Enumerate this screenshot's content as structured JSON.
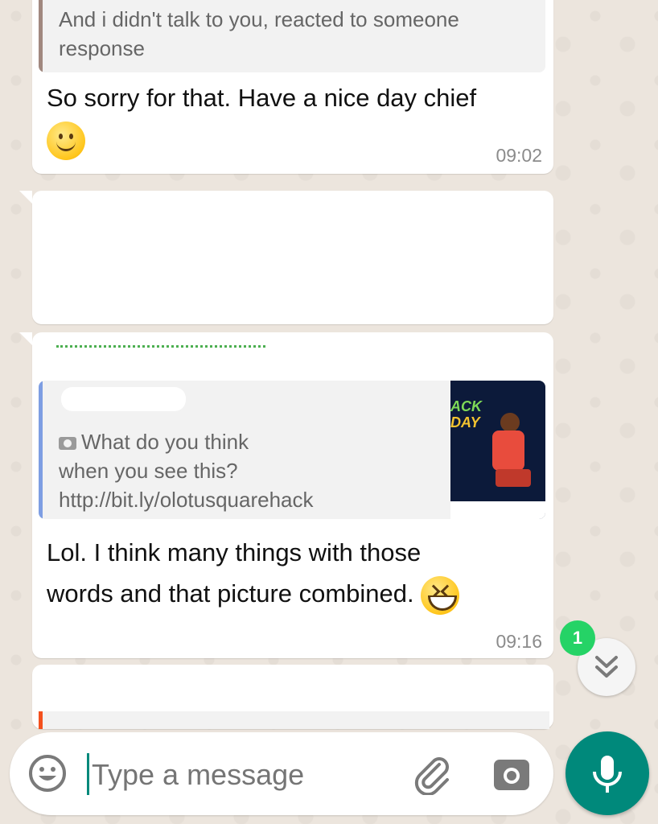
{
  "messages": [
    {
      "quote_text": "And i didn't talk to you, reacted to someone response",
      "body": "So sorry for that. Have a nice day chief",
      "emoji": "slightly-smiling-face",
      "time": "09:02"
    },
    {
      "quote_camera_icon": "camera-icon",
      "quote_text_line1": "What do you think",
      "quote_text_line2": "when you see this?",
      "quote_link": "http://bit.ly/olotusquarehack",
      "quote_thumb_title_1": "ACK",
      "quote_thumb_title_2": "DAY",
      "body_line1": "Lol. I think many things with those",
      "body_line2": "words and that picture combined.",
      "emoji": "grinning-squinting-face",
      "time": "09:16"
    }
  ],
  "scroll_button": {
    "unread_count": "1",
    "icon": "chevron-double-down-icon"
  },
  "composer": {
    "placeholder": "Type a message",
    "emoji_icon": "emoji-icon",
    "attach_icon": "paperclip-icon",
    "camera_icon": "camera-icon",
    "mic_icon": "mic-icon"
  },
  "colors": {
    "accent": "#00897b",
    "badge": "#25d366",
    "quote_bar_1": "#a1887f",
    "quote_bar_2": "#7e9ee3",
    "quote_bar_3": "#f4511e"
  }
}
